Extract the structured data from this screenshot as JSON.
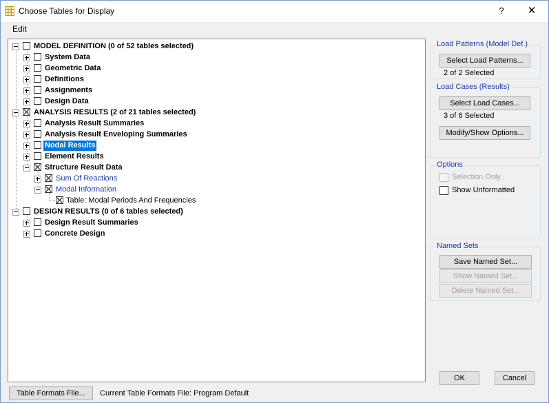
{
  "window": {
    "title": "Choose Tables for Display",
    "help": "?",
    "close": "✕"
  },
  "menu": {
    "edit": "Edit"
  },
  "tree": {
    "model_definition": "MODEL DEFINITION  (0 of 52 tables selected)",
    "system_data": "System Data",
    "geometric_data": "Geometric Data",
    "definitions": "Definitions",
    "assignments": "Assignments",
    "design_data": "Design Data",
    "analysis_results": "ANALYSIS RESULTS  (2 of 21 tables selected)",
    "analysis_result_summaries": "Analysis Result Summaries",
    "analysis_result_enveloping": "Analysis Result Enveloping Summaries",
    "nodal_results": "Nodal Results",
    "element_results": "Element Results",
    "structure_result_data": "Structure Result Data",
    "sum_of_reactions": "Sum Of Reactions",
    "modal_information": "Modal Information",
    "modal_periods_table": "Table:  Modal Periods And Frequencies",
    "design_results": "DESIGN RESULTS  (0 of 6 tables selected)",
    "design_result_summaries": "Design Result Summaries",
    "concrete_design": "Concrete Design"
  },
  "load_patterns": {
    "title": "Load Patterns (Model Def.)",
    "button": "Select Load Patterns...",
    "status": "2 of 2 Selected"
  },
  "load_cases": {
    "title": "Load Cases (Results)",
    "button": "Select Load Cases...",
    "status": "3 of 6 Selected",
    "modify": "Modify/Show Options..."
  },
  "options": {
    "title": "Options",
    "selection_only": "Selection Only",
    "show_unformatted": "Show Unformatted"
  },
  "named_sets": {
    "title": "Named Sets",
    "save": "Save Named Set...",
    "show": "Show Named Set...",
    "delete": "Delete Named Set..."
  },
  "footer": {
    "table_formats_button": "Table Formats File...",
    "current_file": "Current Table Formats File:  Program Default",
    "ok": "OK",
    "cancel": "Cancel"
  }
}
